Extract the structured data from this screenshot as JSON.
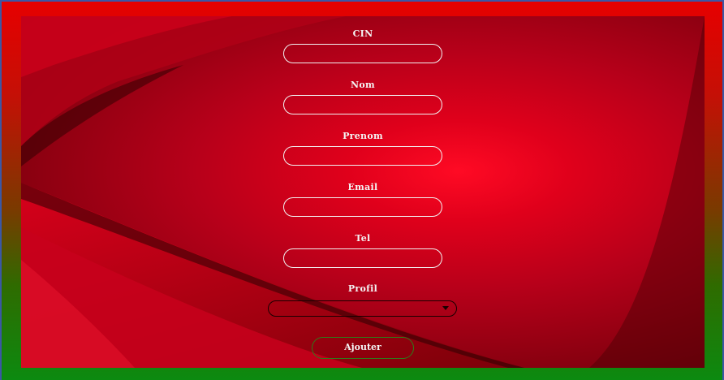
{
  "form": {
    "cin_label": "CIN",
    "nom_label": "Nom",
    "prenom_label": "Prenom",
    "email_label": "Email",
    "tel_label": "Tel",
    "profil_label": "Profil",
    "cin_value": "",
    "nom_value": "",
    "prenom_value": "",
    "email_value": "",
    "tel_value": "",
    "profil_selected": "",
    "submit_label": "Ajouter"
  },
  "colors": {
    "frame_top": "#e60000",
    "frame_bottom": "#0c8a10",
    "frame_border": "#3b57a5",
    "panel_center": "#ff0a24",
    "panel_edge": "#5c0008",
    "field_border": "#f2f2f2",
    "button_border": "#2f7a1a"
  },
  "icons": {
    "select_arrow": "chevron-down-icon"
  }
}
